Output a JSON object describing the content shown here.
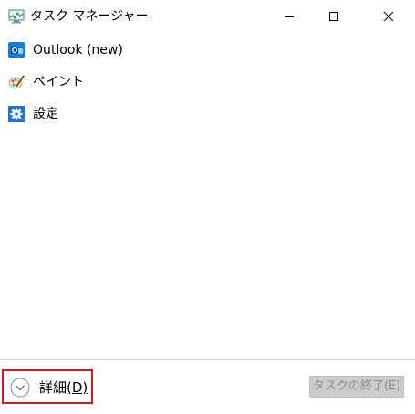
{
  "window": {
    "title": "タスク マネージャー",
    "icon": "task-manager-icon"
  },
  "apps": [
    {
      "label": "Outlook (new)",
      "icon": "outlook-icon"
    },
    {
      "label": "ペイント",
      "icon": "paint-icon"
    },
    {
      "label": "設定",
      "icon": "settings-gear-icon"
    }
  ],
  "footer": {
    "details_label": "詳細",
    "details_shortcut": "(D)",
    "details_icon": "chevron-down-circle-icon",
    "end_task_label": "タスクの終了(E)"
  },
  "colors": {
    "highlight_border": "#e0141e",
    "disabled_button_bg": "#cccccc",
    "disabled_text": "#8c8c8c"
  }
}
